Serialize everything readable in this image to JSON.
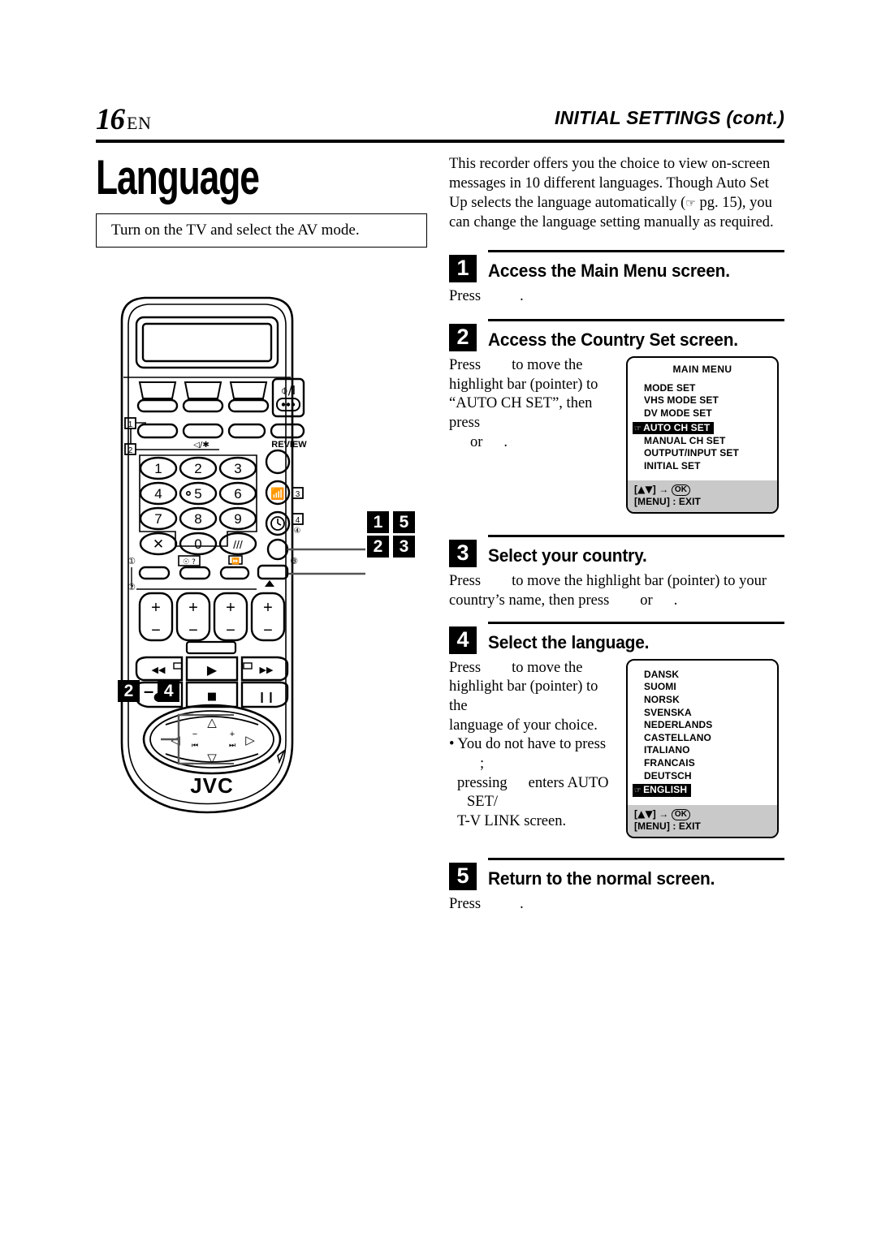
{
  "header": {
    "page_number": "16",
    "lang_code": "EN",
    "running_head": "INITIAL SETTINGS",
    "running_head_cont": "(cont.)"
  },
  "left": {
    "title": "Language",
    "note": "Turn on the TV and select the AV mode."
  },
  "intro": {
    "line1": "This recorder offers you the choice to view on-screen",
    "line2": "messages in 10 different languages. Though Auto Set Up",
    "line3_a": "selects the language automatically (",
    "line3_pointer": "☞",
    "line3_b": " pg. 15), you can",
    "line4": "change the language setting manually as required."
  },
  "steps": [
    {
      "number": "1",
      "title": "Access the Main Menu screen.",
      "body_pre": "Press",
      "body_post": "."
    },
    {
      "number": "2",
      "title": "Access the Country Set screen.",
      "line1_pre": "Press",
      "line1_post": "to move the",
      "line2": "highlight bar (pointer) to",
      "line3": "“AUTO CH SET”, then press",
      "line4_or": "or",
      "line4_end": "."
    },
    {
      "number": "3",
      "title": "Select your country.",
      "line1_pre": "Press",
      "line1_post": "to move the highlight bar (pointer) to your",
      "line2_pre": "country’s name, then press",
      "line2_or": "or",
      "line2_end": "."
    },
    {
      "number": "4",
      "title": "Select the language.",
      "line1_pre": "Press",
      "line1_post": "to move the",
      "line2": "highlight bar (pointer) to the",
      "line3": "language of your choice.",
      "bullet1_pre": "• You do not have to press",
      "bullet1_post": ";",
      "bullet2_pre": "pressing",
      "bullet2_post": "enters AUTO SET/",
      "bullet3": "T-V LINK screen."
    },
    {
      "number": "5",
      "title": "Return to the normal screen.",
      "body_pre": "Press",
      "body_post": "."
    }
  ],
  "osd_main_menu": {
    "title": "MAIN MENU",
    "items": [
      {
        "label": "MODE SET",
        "selected": false
      },
      {
        "label": "VHS MODE SET",
        "selected": false
      },
      {
        "label": "DV MODE SET",
        "selected": false
      },
      {
        "label": "AUTO CH SET",
        "selected": true
      },
      {
        "label": "MANUAL CH SET",
        "selected": false
      },
      {
        "label": "OUTPUT/INPUT SET",
        "selected": false
      },
      {
        "label": "INITIAL SET",
        "selected": false
      }
    ],
    "footer_nav_left": "[",
    "footer_nav_arrows": "▲▼",
    "footer_nav_mid": "] → ",
    "footer_ok": "OK",
    "footer_exit": "[MENU] : EXIT",
    "pointer_glyph": "☞"
  },
  "osd_language": {
    "items": [
      {
        "label": "DANSK",
        "selected": false
      },
      {
        "label": "SUOMI",
        "selected": false
      },
      {
        "label": "NORSK",
        "selected": false
      },
      {
        "label": "SVENSKA",
        "selected": false
      },
      {
        "label": "NEDERLANDS",
        "selected": false
      },
      {
        "label": "CASTELLANO",
        "selected": false
      },
      {
        "label": "ITALIANO",
        "selected": false
      },
      {
        "label": "FRANCAIS",
        "selected": false
      },
      {
        "label": "DEUTSCH",
        "selected": false
      },
      {
        "label": "ENGLISH",
        "selected": true
      }
    ],
    "footer_nav_left": "[",
    "footer_nav_arrows": "▲▼",
    "footer_nav_mid": "] → ",
    "footer_ok": "OK",
    "footer_exit": "[MENU] : EXIT",
    "pointer_glyph": "☞"
  },
  "callouts": {
    "right_top": [
      "1",
      "5"
    ],
    "right_bottom": [
      "2",
      "3"
    ],
    "left_range_start": "2",
    "left_range_dash": "–",
    "left_range_end": "4"
  },
  "remote": {
    "brand": "JVC",
    "power_label": "⏻/I",
    "review_label": "REVIEW",
    "keypad": [
      "1",
      "2",
      "3",
      "4",
      "5",
      "6",
      "7",
      "8",
      "9"
    ],
    "keypad_extra": [
      "✕",
      "0"
    ],
    "marker_1": "1",
    "marker_2": "2",
    "marker_3": "3",
    "marker_4": "4",
    "circled_1": "①",
    "circled_2": "②",
    "circled_3": "③",
    "circled_4": "④",
    "play_glyph": "▶",
    "rew_glyph": "◀◀",
    "ff_glyph": "▶▶",
    "rec_glyph": "●",
    "stop_glyph": "■",
    "pause_glyph": "❙❙",
    "plus": "+",
    "minus": "−",
    "up_glyph": "△",
    "down_glyph": "▽",
    "left_glyph": "◁",
    "right_glyph": "▷",
    "prev_glyph": "⏮",
    "next_glyph": "⏭"
  }
}
